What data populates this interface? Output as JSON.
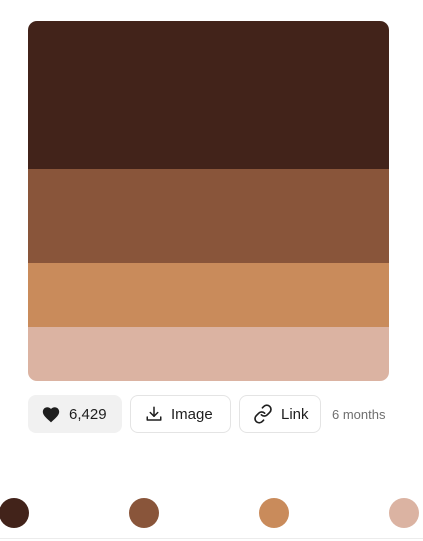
{
  "palette": {
    "colors": [
      "#42231a",
      "#89553a",
      "#c98b5b",
      "#dbb3a2"
    ]
  },
  "actions": {
    "likes_count": "6,429",
    "image_label": "Image",
    "link_label": "Link",
    "age_text": "6 months"
  },
  "dots": {
    "colors": [
      "#42231a",
      "#89553a",
      "#c98b5b",
      "#dbb3a2"
    ]
  }
}
